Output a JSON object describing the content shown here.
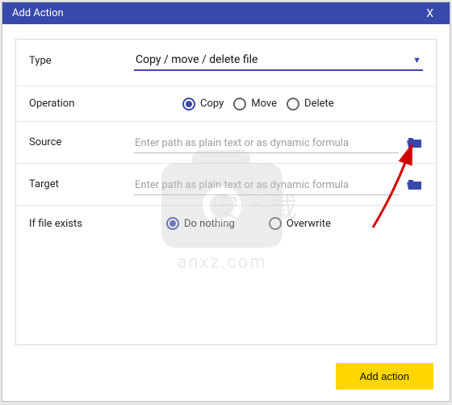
{
  "dialog": {
    "title": "Add Action",
    "close_label": "X"
  },
  "type_row": {
    "label": "Type",
    "value": "Copy / move / delete file"
  },
  "operation": {
    "label": "Operation",
    "options": {
      "copy": "Copy",
      "move": "Move",
      "delete": "Delete"
    },
    "selected": "copy"
  },
  "source": {
    "label": "Source",
    "placeholder": "Enter path as plain text or as dynamic formula",
    "value": ""
  },
  "target": {
    "label": "Target",
    "placeholder": "Enter path as plain text or as dynamic formula",
    "value": ""
  },
  "if_exists": {
    "label": "If file exists",
    "options": {
      "do_nothing": "Do nothing",
      "overwrite": "Overwrite"
    },
    "selected": "do_nothing"
  },
  "footer": {
    "add_label": "Add action"
  },
  "colors": {
    "primary": "#3949ab",
    "accent": "#ffd600"
  },
  "watermark": {
    "text": "安下载",
    "domain": "anxz.com"
  }
}
